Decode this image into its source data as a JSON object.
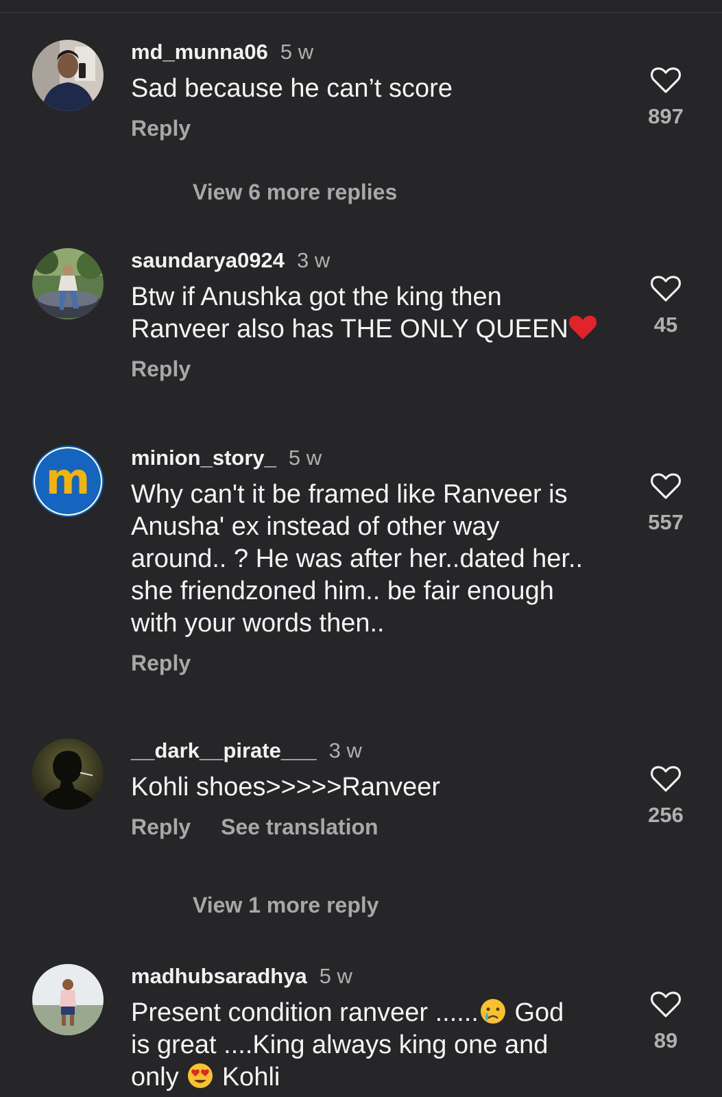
{
  "comments": [
    {
      "username": "md_munna06",
      "time": "5 w",
      "text": "Sad because he can’t score",
      "reply_label": "Reply",
      "likes": "897",
      "more_replies": "View 6 more replies",
      "avatar": "man-mirror-selfie-photo"
    },
    {
      "username": "saundarya0924",
      "time": "3 w",
      "text_lines": [
        "Btw if Anushka got the king then",
        "Ranveer also has THE ONLY QUEEN"
      ],
      "emoji": "red-heart-icon",
      "reply_label": "Reply",
      "likes": "45",
      "avatar": "woman-on-car-photo"
    },
    {
      "username": "minion_story_",
      "time": "5 w",
      "text_lines": [
        "Why can't it be framed like Ranveer is",
        "Anusha' ex instead of other way",
        "around.. ? He was after her..dated her..",
        "she friendzoned him.. be fair enough",
        "with your words then.."
      ],
      "reply_label": "Reply",
      "likes": "557",
      "avatar_letter": "m",
      "avatar_colors": {
        "bg": "#1565c0",
        "letter": "#f5b400"
      }
    },
    {
      "username": "__dark__pirate___",
      "time": "3 w",
      "text": "Kohli shoes>>>>>Ranveer",
      "reply_label": "Reply",
      "translate_label": "See translation",
      "likes": "256",
      "more_replies": "View 1 more reply",
      "avatar": "silhouette-smoking-photo"
    },
    {
      "username": "madhubsaradhya",
      "time": "5 w",
      "text_parts": [
        "Present condition ranveer ......",
        " God",
        "is great ....King always king one and",
        "only ",
        " Kohli"
      ],
      "emojis": [
        "crying-face-icon",
        "heart-eyes-face-icon"
      ],
      "likes": "89",
      "avatar": "man-outdoors-photo"
    }
  ]
}
